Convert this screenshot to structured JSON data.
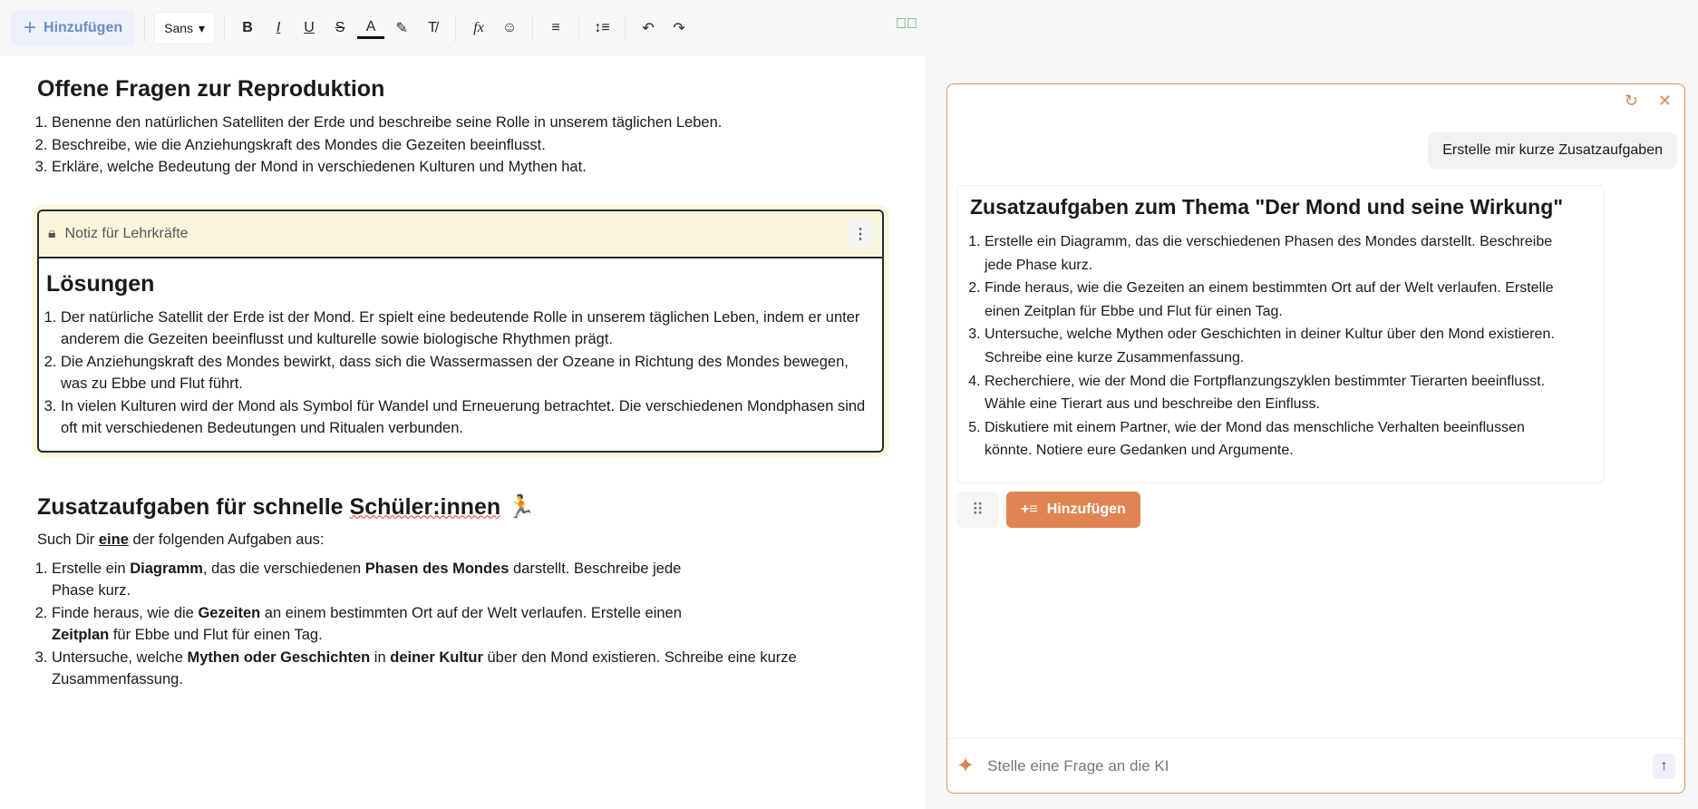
{
  "toolbar": {
    "add_label": "Hinzufügen",
    "font": "Sans",
    "bold": "B",
    "italic": "I",
    "underline": "U",
    "strike": "S",
    "color": "A",
    "formula": "fx"
  },
  "doc": {
    "heading1": "Offene Fragen zur Reproduktion",
    "questions": [
      "Benenne den natürlichen Satelliten der Erde und beschreibe seine Rolle in unserem täglichen Leben.",
      "Beschreibe, wie die Anziehungskraft des Mondes die Gezeiten beeinflusst.",
      "Erkläre, welche Bedeutung der Mond in verschiedenen Kulturen und Mythen hat."
    ],
    "note": {
      "label": "Notiz für Lehrkräfte",
      "title": "Lösungen",
      "items": [
        "Der natürliche Satellit der Erde ist der Mond. Er spielt eine bedeutende Rolle in unserem täglichen Leben, indem er unter anderem die Gezeiten beeinflusst und kulturelle sowie biologische Rhythmen prägt.",
        "Die Anziehungskraft des Mondes bewirkt, dass sich die Wassermassen der Ozeane in Richtung des Mondes bewegen, was zu Ebbe und Flut führt.",
        "In vielen Kulturen wird der Mond als Symbol für Wandel und Erneuerung betrachtet. Die verschiedenen Mondphasen sind oft mit verschiedenen Bedeutungen und Ritualen verbunden."
      ]
    },
    "heading2_a": "Zusatzaufgaben für schnelle ",
    "heading2_b": "Schüler:innen",
    "heading2_emoji": "🏃",
    "intro_a": "Such Dir ",
    "intro_b": "eine",
    "intro_c": " der folgenden Aufgaben aus:",
    "tasks": [
      [
        "Erstelle ein ",
        "Diagramm",
        ", das die verschiedenen ",
        "Phasen des Mondes",
        " darstellt. Beschreibe jede Phase kurz."
      ],
      [
        "Finde heraus, wie die ",
        "Gezeiten",
        " an einem bestimmten Ort auf der Welt verlaufen. Erstelle einen ",
        "Zeitplan",
        " für Ebbe und Flut für einen Tag."
      ],
      [
        "Untersuche, welche ",
        "Mythen oder Geschichten",
        " in ",
        "deiner Kultur",
        " über den Mond existieren. Schreibe eine kurze Zusammenfassung."
      ]
    ]
  },
  "chat": {
    "user_message": "Erstelle mir kurze Zusatzaufgaben",
    "answer_title": "Zusatzaufgaben zum Thema \"Der Mond und seine Wirkung\"",
    "answer_items": [
      "Erstelle ein Diagramm, das die verschiedenen Phasen des Mondes darstellt. Beschreibe jede Phase kurz.",
      "Finde heraus, wie die Gezeiten an einem bestimmten Ort auf der Welt verlaufen. Erstelle einen Zeitplan für Ebbe und Flut für einen Tag.",
      "Untersuche, welche Mythen oder Geschichten in deiner Kultur über den Mond existieren. Schreibe eine kurze Zusammenfassung.",
      "Recherchiere, wie der Mond die Fortpflanzungszyklen bestimmter Tierarten beeinflusst. Wähle eine Tierart aus und beschreibe den Einfluss.",
      "Diskutiere mit einem Partner, wie der Mond das menschliche Verhalten beeinflussen könnte. Notiere eure Gedanken und Argumente."
    ],
    "add_label": "Hinzufügen",
    "input_placeholder": "Stelle eine Frage an die KI"
  },
  "colors": {
    "accent": "#e08552",
    "note_bg": "#faf6dc"
  }
}
